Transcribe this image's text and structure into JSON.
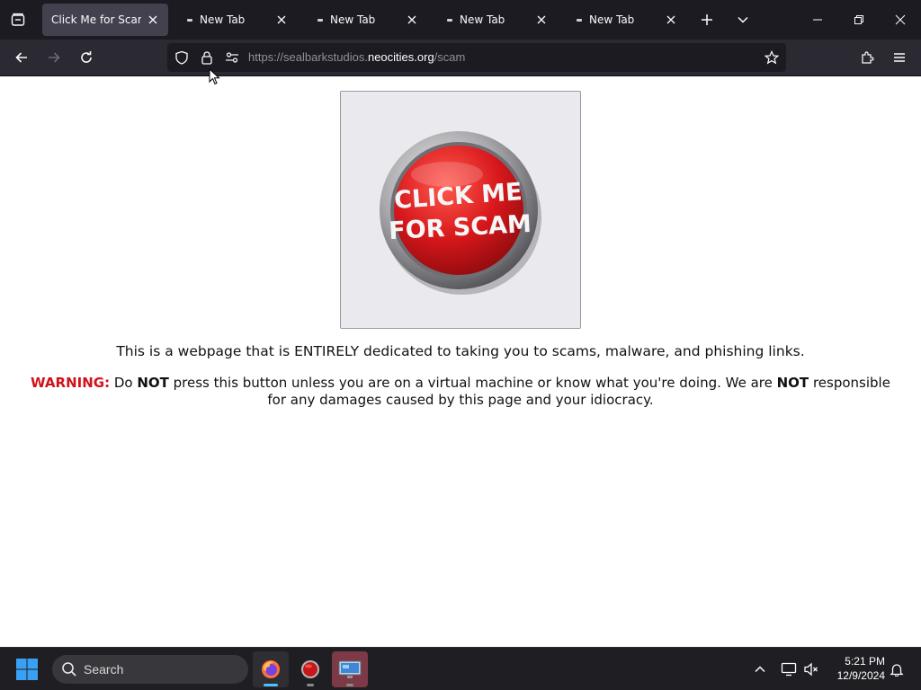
{
  "browser": {
    "tabs": [
      {
        "title": "Click Me for Scam!",
        "active": true
      },
      {
        "title": "New Tab",
        "active": false
      },
      {
        "title": "New Tab",
        "active": false
      },
      {
        "title": "New Tab",
        "active": false
      },
      {
        "title": "New Tab",
        "active": false
      }
    ],
    "url": {
      "scheme": "https://sealbarkstudios.",
      "host": "neocities.org",
      "path": "/scam"
    }
  },
  "page": {
    "image_text": "CLICK ME FOR SCAM",
    "intro": "This is a webpage that is ENTIRELY dedicated to taking you to scams, malware, and phishing links.",
    "warning": {
      "label": "WARNING:",
      "part1": " Do ",
      "not1": "NOT",
      "part2": " press this button unless you are on a virtual machine or know what you're doing. We are ",
      "not2": "NOT",
      "part3": " responsible for any damages caused by this page and your idiocracy."
    }
  },
  "taskbar": {
    "search_label": "Search",
    "time": "5:21 PM",
    "date": "12/9/2024"
  },
  "colors": {
    "warning_red": "#d1121b",
    "button_red": "#d8181c",
    "active_indicator": "#4cc2ff"
  }
}
